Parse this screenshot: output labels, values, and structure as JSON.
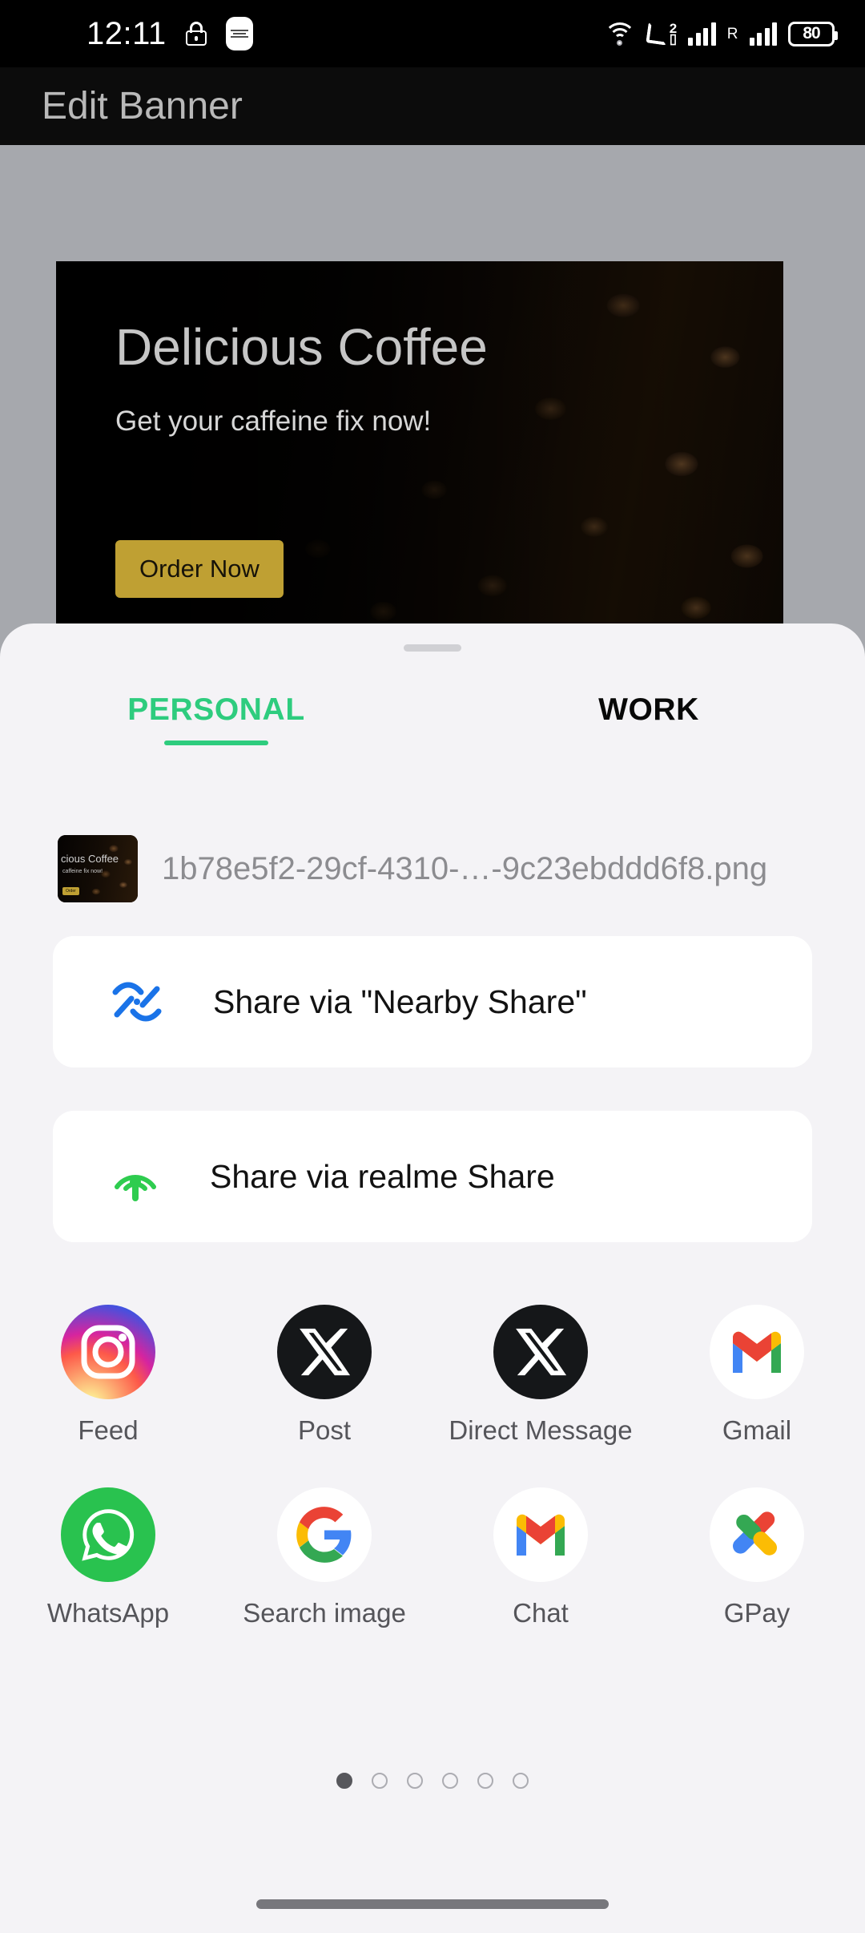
{
  "status_bar": {
    "time": "12:11",
    "lock_icon": "lock-icon",
    "notification_icon": "notification-chip-icon",
    "wifi_icon": "wifi-icon",
    "volte_icon": "volte-call-icon",
    "sim_label": "2",
    "signal_icon": "signal-bars-icon",
    "roaming_label": "R",
    "roaming_signal_icon": "roaming-signal-bars-icon",
    "battery_level": "80"
  },
  "app_bar": {
    "title": "Edit Banner"
  },
  "banner": {
    "title": "Delicious Coffee",
    "subtitle": "Get your caffeine fix now!",
    "button_label": "Order Now",
    "button_color": "#bfa033",
    "background": "coffee-beans-photo"
  },
  "share_sheet": {
    "grabber": "drag-handle",
    "tabs": [
      {
        "label": "PERSONAL",
        "active": true
      },
      {
        "label": "WORK",
        "active": false
      }
    ],
    "accent_color": "#2ecc7e",
    "file": {
      "name": "1b78e5f2-29cf-4310-…-9c23ebddd6f8.png",
      "thumbnail_title": "cious Coffee",
      "thumbnail_subtitle": "caffeine fix now!",
      "thumbnail_button": "Order"
    },
    "quick_actions": [
      {
        "label": "Share via \"Nearby Share\"",
        "icon": "nearby-share-icon",
        "color": "#1a73e8"
      },
      {
        "label": "Share via realme Share",
        "icon": "realme-share-icon",
        "color": "#2ecc4f"
      }
    ],
    "apps": [
      {
        "label": "Feed",
        "icon": "instagram-icon"
      },
      {
        "label": "Post",
        "icon": "x-twitter-icon"
      },
      {
        "label": "Direct Message",
        "icon": "x-twitter-icon"
      },
      {
        "label": "Gmail",
        "icon": "gmail-icon"
      },
      {
        "label": "WhatsApp",
        "icon": "whatsapp-icon"
      },
      {
        "label": "Search image",
        "icon": "google-icon"
      },
      {
        "label": "Chat",
        "icon": "gmail-icon"
      },
      {
        "label": "GPay",
        "icon": "google-pay-icon"
      }
    ],
    "pagination": {
      "total": 6,
      "current": 1
    }
  },
  "navigation_bar": {
    "home_indicator": "home-gesture-pill"
  }
}
